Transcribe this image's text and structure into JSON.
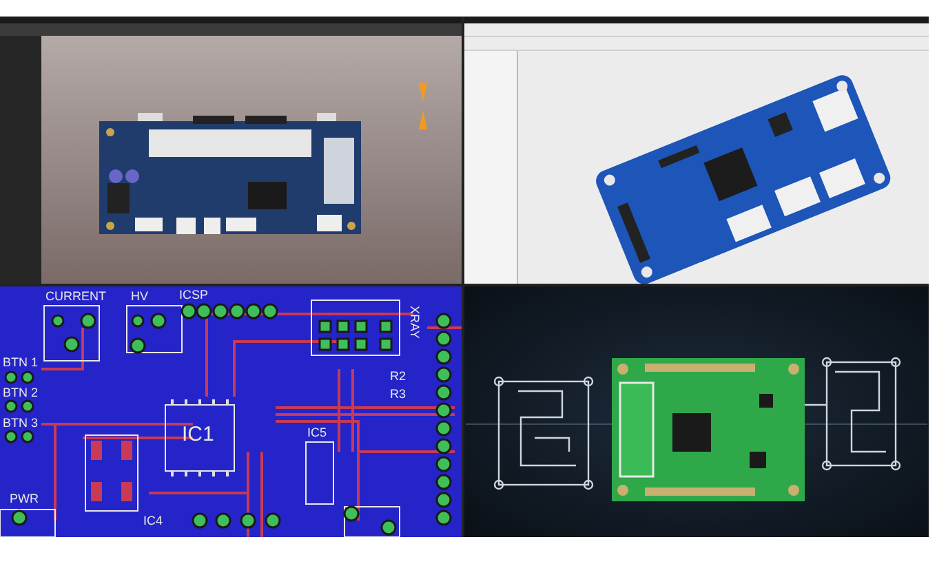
{
  "panels": [
    {
      "kind": "viewer_3d"
    },
    {
      "kind": "cad_3d"
    },
    {
      "kind": "layout",
      "labels": [
        "CURRENT",
        "HV",
        "ICSP",
        "BTN 1",
        "BTN 2",
        "BTN 3",
        "IC1",
        "IC5",
        "IC4",
        "PWR",
        "XRAY",
        "R2",
        "R3"
      ]
    },
    {
      "kind": "render"
    }
  ]
}
